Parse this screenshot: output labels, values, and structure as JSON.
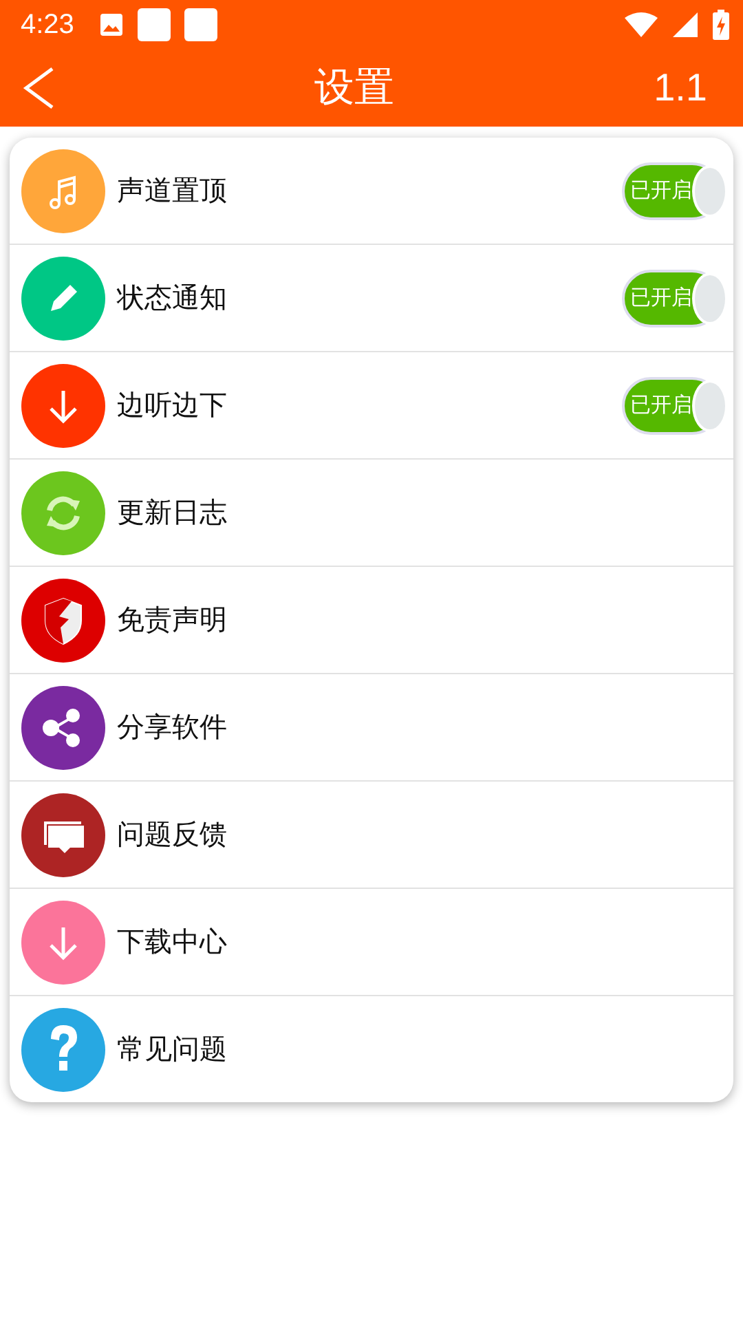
{
  "status_bar": {
    "time": "4:23"
  },
  "app_bar": {
    "title": "设置",
    "version": "1.1"
  },
  "items": [
    {
      "label": "声道置顶",
      "kind": "toggle",
      "on": true,
      "toggle_text": "已开启",
      "color": "#ffa63a"
    },
    {
      "label": "状态通知",
      "kind": "toggle",
      "on": true,
      "toggle_text": "已开启",
      "color": "#00c785"
    },
    {
      "label": "边听边下",
      "kind": "toggle",
      "on": true,
      "toggle_text": "已开启",
      "color": "#ff3300"
    },
    {
      "label": "更新日志",
      "kind": "link",
      "color": "#6cc61e"
    },
    {
      "label": "免责声明",
      "kind": "link",
      "color": "#dd0000"
    },
    {
      "label": "分享软件",
      "kind": "link",
      "color": "#7a2aa0"
    },
    {
      "label": "问题反馈",
      "kind": "link",
      "color": "#ad2424"
    },
    {
      "label": "下载中心",
      "kind": "link",
      "color": "#fb749a"
    },
    {
      "label": "常见问题",
      "kind": "link",
      "color": "#27a8e2"
    }
  ]
}
